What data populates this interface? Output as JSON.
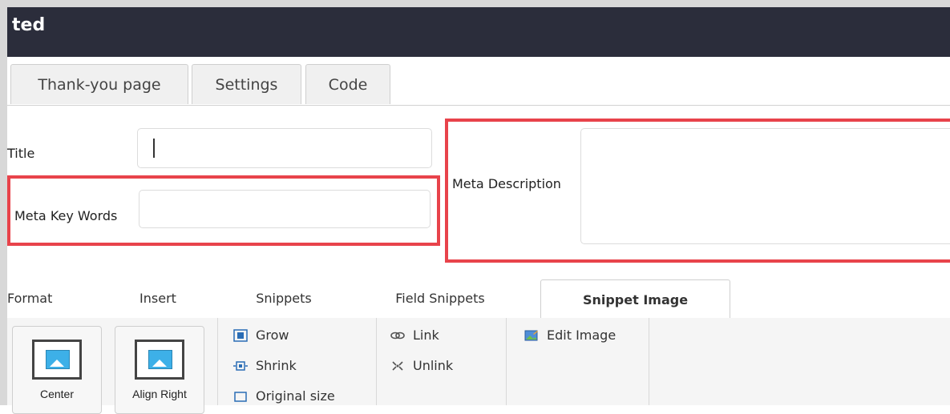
{
  "window": {
    "title": "ted"
  },
  "tabs": [
    {
      "label": "Thank-you page"
    },
    {
      "label": "Settings"
    },
    {
      "label": "Code"
    }
  ],
  "form": {
    "title_label": "Title",
    "title_value": "",
    "keywords_label": "Meta Key Words",
    "keywords_value": "",
    "description_label": "Meta Description",
    "description_value": ""
  },
  "highlight_color": "#e8434b",
  "ribbon_tabs": [
    {
      "label": "Format"
    },
    {
      "label": "Insert"
    },
    {
      "label": "Snippets"
    },
    {
      "label": "Field Snippets"
    },
    {
      "label": "Snippet Image",
      "active": true
    }
  ],
  "ribbon": {
    "center": "Center",
    "align_right": "Align Right",
    "grow": "Grow",
    "shrink": "Shrink",
    "original_size": "Original size",
    "link": "Link",
    "unlink": "Unlink",
    "edit_image": "Edit Image"
  }
}
